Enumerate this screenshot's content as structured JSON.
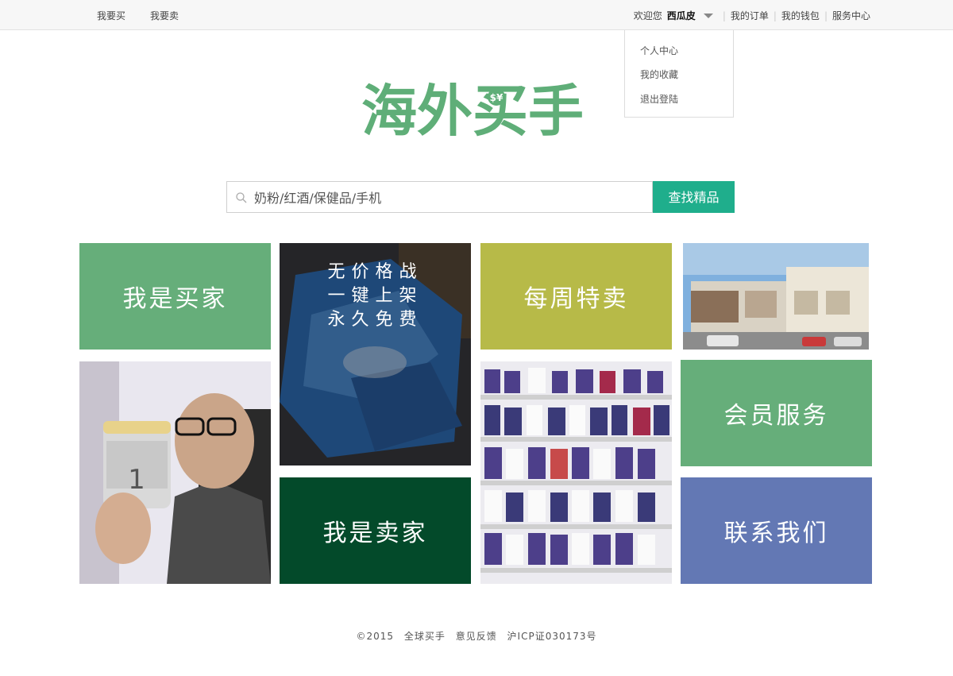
{
  "topbar": {
    "left_links": [
      "我要买",
      "我要卖"
    ],
    "welcome": "欢迎您",
    "username": "西瓜皮",
    "right_links": [
      "我的订单",
      "我的钱包",
      "服务中心"
    ]
  },
  "dropdown": {
    "items": [
      "个人中心",
      "我的收藏",
      "退出登陆"
    ]
  },
  "logo": {
    "text": "海外买手",
    "symbol": "$¥"
  },
  "search": {
    "placeholder": "奶粉/红酒/保健品/手机",
    "button": "查找精品",
    "icon": "search-icon"
  },
  "tiles": {
    "buyer": "我是买家",
    "promo_lines": [
      "无价格战",
      "一键上架",
      "永久免费"
    ],
    "weekly": "每周特卖",
    "member": "会员服务",
    "seller": "我是卖家",
    "contact": "联系我们"
  },
  "footer": {
    "items": [
      "©2015",
      "全球买手",
      "意见反馈",
      "沪ICP证030173号"
    ]
  },
  "colors": {
    "green": "#66ae7a",
    "olive": "#b7ba48",
    "dark_green": "#034a2a",
    "blue": "#6378b4",
    "teal_button": "#1fae8c"
  }
}
